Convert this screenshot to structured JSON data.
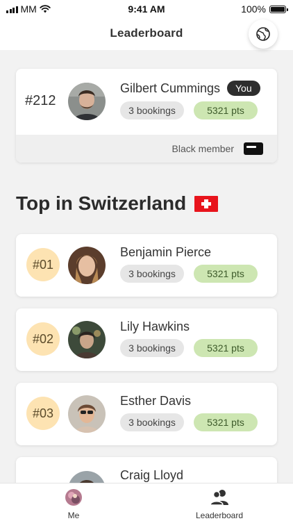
{
  "status_bar": {
    "carrier": "MM",
    "time": "9:41 AM",
    "battery": "100%"
  },
  "nav": {
    "title": "Leaderboard",
    "globe_icon": "globe-icon"
  },
  "me": {
    "rank": "#212",
    "name": "Gilbert Cummings",
    "you_badge": "You",
    "bookings": "3 bookings",
    "points": "5321 pts",
    "membership": "Black member",
    "membership_icon": "card-icon"
  },
  "section": {
    "title": "Top in Switzerland",
    "flag_icon": "swiss-flag-icon"
  },
  "leaders": [
    {
      "rank": "#01",
      "name": "Benjamin Pierce",
      "bookings": "3 bookings",
      "points": "5321 pts"
    },
    {
      "rank": "#02",
      "name": "Lily Hawkins",
      "bookings": "3 bookings",
      "points": "5321 pts"
    },
    {
      "rank": "#03",
      "name": "Esther Davis",
      "bookings": "3 bookings",
      "points": "5321 pts"
    },
    {
      "rank": "",
      "name": "Craig Lloyd",
      "bookings": "",
      "points": ""
    }
  ],
  "tabs": [
    {
      "label": "Me",
      "icon": "avatar-icon"
    },
    {
      "label": "Leaderboard",
      "icon": "people-icon"
    }
  ],
  "colors": {
    "background": "#f2f2f2",
    "points_pill": "#cde6b2",
    "bookings_pill": "#e6e6e6",
    "rank_circle": "#fde3b2",
    "you_badge": "#2e2e2e",
    "flag_red": "#e8141c"
  }
}
